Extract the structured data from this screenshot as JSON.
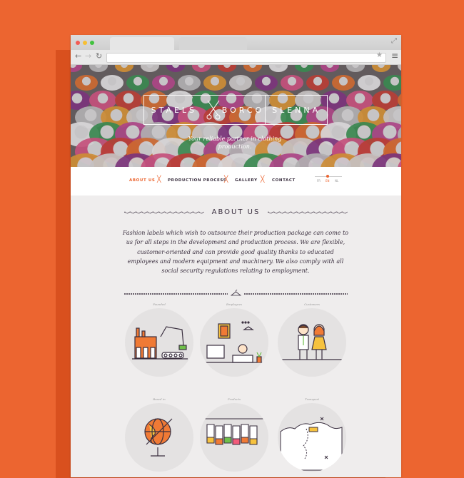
{
  "browser": {
    "url": "",
    "window_dots": [
      "#f25b53",
      "#f7bf32",
      "#42c23f"
    ]
  },
  "hero": {
    "logo": [
      "STAELS",
      "BORCO",
      "SLENNA"
    ],
    "tagline_line1": "Your reliable partner in clothing",
    "tagline_line2": "production."
  },
  "nav": {
    "items": [
      "ABOUT US",
      "PRODUCTION PROCESS",
      "GALLERY",
      "CONTACT"
    ],
    "active": 0,
    "languages": [
      "FR",
      "EN",
      "NL"
    ]
  },
  "about": {
    "title": "ABOUT US",
    "lines": [
      "Fashion labels which wish to outsource their production package can come to",
      "us for all steps in the development and production process. We are flexible,",
      "customer-oriented and can provide good quality thanks to educated",
      "employees and modern equipment and machinery. We also comply with all",
      "social security regulations relating to employment."
    ]
  },
  "features": [
    {
      "label": "Founded",
      "icon": "factory-icon"
    },
    {
      "label": "Employees",
      "icon": "office-worker-icon"
    },
    {
      "label": "Customers",
      "icon": "customers-icon"
    },
    {
      "label": "Based in",
      "icon": "globe-icon"
    },
    {
      "label": "Products",
      "icon": "clothing-rack-icon"
    },
    {
      "label": "Transport",
      "icon": "map-transport-icon"
    }
  ],
  "colors": {
    "accent": "#ec6530",
    "text": "#3a2f3f",
    "page_bg": "#efeded"
  }
}
